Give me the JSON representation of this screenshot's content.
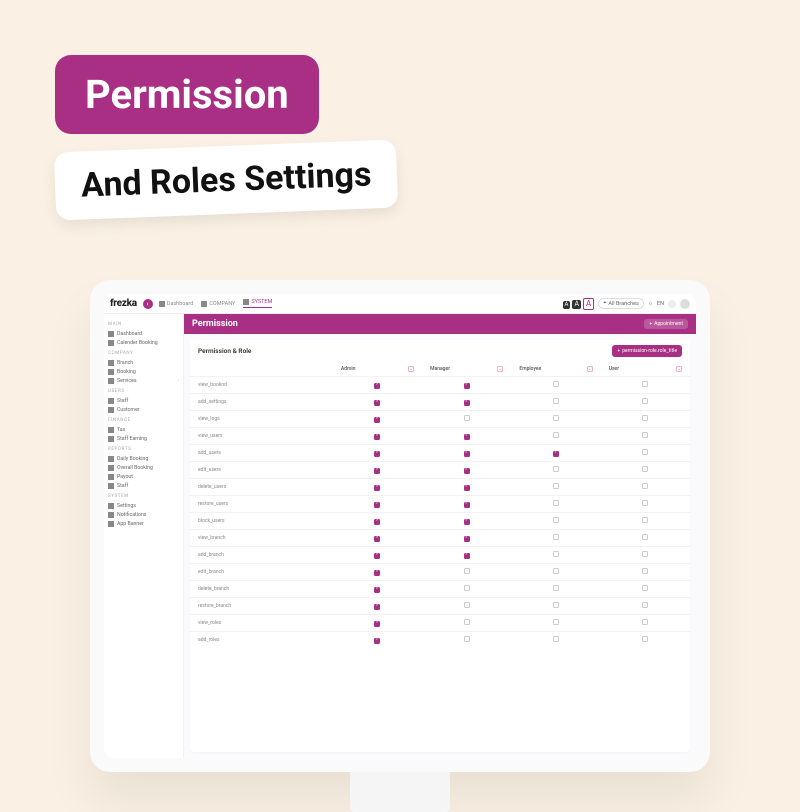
{
  "hero": {
    "line1": "Permission",
    "line2": "And Roles Settings"
  },
  "brand": "frezka",
  "topnav": [
    {
      "label": "Dashboard",
      "icon": "dashboard-icon",
      "active": false
    },
    {
      "label": "COMPANY",
      "icon": "company-icon",
      "active": false
    },
    {
      "label": "SYSTEM",
      "icon": "gear-icon",
      "active": true
    }
  ],
  "topright": {
    "branches_label": "All Branches",
    "lang": "EN"
  },
  "sidebar": {
    "sections": [
      {
        "title": "MAIN",
        "items": [
          {
            "label": "Dashboard",
            "icon": "gauge-icon"
          },
          {
            "label": "Calender Booking",
            "icon": "calendar-icon"
          }
        ]
      },
      {
        "title": "COMPANY",
        "items": [
          {
            "label": "Branch",
            "icon": "branch-icon"
          },
          {
            "label": "Booking",
            "icon": "booking-icon"
          },
          {
            "label": "Services",
            "icon": "services-icon",
            "expandable": true
          }
        ]
      },
      {
        "title": "USERS",
        "items": [
          {
            "label": "Staff",
            "icon": "staff-icon"
          },
          {
            "label": "Customer",
            "icon": "customer-icon"
          }
        ]
      },
      {
        "title": "FINANCE",
        "items": [
          {
            "label": "Tax",
            "icon": "tax-icon"
          },
          {
            "label": "Staff Earning",
            "icon": "earning-icon"
          }
        ]
      },
      {
        "title": "REPORTS",
        "items": [
          {
            "label": "Daily Booking",
            "icon": "report-icon"
          },
          {
            "label": "Overall Booking",
            "icon": "report-icon"
          },
          {
            "label": "Payout",
            "icon": "payout-icon"
          },
          {
            "label": "Staff",
            "icon": "report-icon"
          }
        ]
      },
      {
        "title": "SYSTEM",
        "items": [
          {
            "label": "Settings",
            "icon": "settings-icon"
          },
          {
            "label": "Notifications",
            "icon": "bell-icon"
          },
          {
            "label": "App Banner",
            "icon": "banner-icon"
          }
        ]
      }
    ]
  },
  "page": {
    "title": "Permission",
    "appointment_btn": "Appointment",
    "panel_title": "Permission & Role",
    "add_role_btn": "permission-role.role_title"
  },
  "roles": [
    "Admin",
    "Manager",
    "Employee",
    "User"
  ],
  "permissions": [
    {
      "name": "view_booknd",
      "checks": [
        true,
        true,
        false,
        false
      ]
    },
    {
      "name": "add_settings",
      "checks": [
        true,
        true,
        false,
        false
      ]
    },
    {
      "name": "view_logs",
      "checks": [
        true,
        false,
        false,
        false
      ]
    },
    {
      "name": "view_users",
      "checks": [
        true,
        true,
        false,
        false
      ]
    },
    {
      "name": "add_users",
      "checks": [
        true,
        true,
        true,
        false
      ]
    },
    {
      "name": "edit_users",
      "checks": [
        true,
        true,
        false,
        false
      ]
    },
    {
      "name": "delete_users",
      "checks": [
        true,
        true,
        false,
        false
      ]
    },
    {
      "name": "restore_users",
      "checks": [
        true,
        true,
        false,
        false
      ]
    },
    {
      "name": "block_users",
      "checks": [
        true,
        true,
        false,
        false
      ]
    },
    {
      "name": "view_branch",
      "checks": [
        true,
        true,
        false,
        false
      ]
    },
    {
      "name": "add_branch",
      "checks": [
        true,
        true,
        false,
        false
      ]
    },
    {
      "name": "edit_branch",
      "checks": [
        true,
        false,
        false,
        false
      ]
    },
    {
      "name": "delete_branch",
      "checks": [
        true,
        false,
        false,
        false
      ]
    },
    {
      "name": "restore_branch",
      "checks": [
        true,
        false,
        false,
        false
      ]
    },
    {
      "name": "view_roles",
      "checks": [
        true,
        false,
        false,
        false
      ]
    },
    {
      "name": "add_roles",
      "checks": [
        true,
        false,
        false,
        false
      ]
    }
  ],
  "colors": {
    "accent": "#a92f84"
  }
}
